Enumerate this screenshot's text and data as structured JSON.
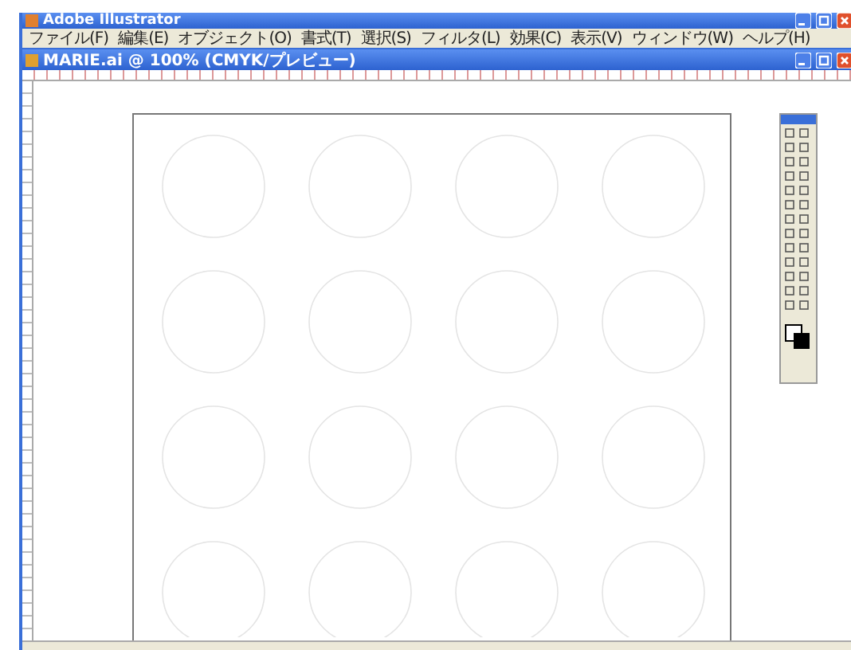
{
  "app_window": {
    "title": "Adobe Illustrator"
  },
  "menu_bar": [
    "ファイル(F)",
    "編集(E)",
    "オブジェクト(O)",
    "書式(T)",
    "選択(S)",
    "フィルタ(L)",
    "効果(C)",
    "表示(V)",
    "ウィンドウ(W)",
    "ヘルプ(H)"
  ],
  "document_window": {
    "title": "MARIE.ai @ 100% (CMYK/プレビュー)"
  }
}
